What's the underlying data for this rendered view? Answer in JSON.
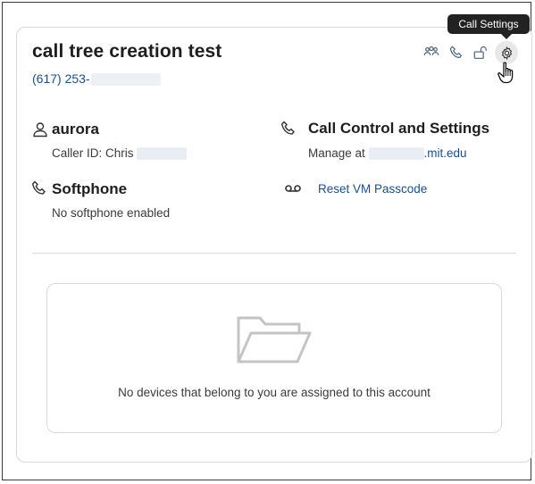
{
  "card": {
    "title": "call tree creation test",
    "phone": "(617) 253-"
  },
  "toolbar": {
    "icons": [
      "group-icon",
      "phone-icon",
      "unlock-icon",
      "gear-icon"
    ],
    "tooltip": "Call Settings"
  },
  "user": {
    "name": "aurora",
    "caller_id": "Caller ID: Chris "
  },
  "call_control": {
    "title": "Call Control and Settings",
    "manage_prefix": "Manage at ",
    "manage_suffix": ".mit.edu"
  },
  "softphone": {
    "title": "Softphone",
    "status": "No softphone enabled"
  },
  "voicemail": {
    "reset_label": "Reset VM Passcode"
  },
  "devices": {
    "empty_message": "No devices that belong to you are assigned to this account"
  },
  "colors": {
    "link": "#1d4e89",
    "icon": "#4b5e7c",
    "tooltip_bg": "#222222"
  }
}
